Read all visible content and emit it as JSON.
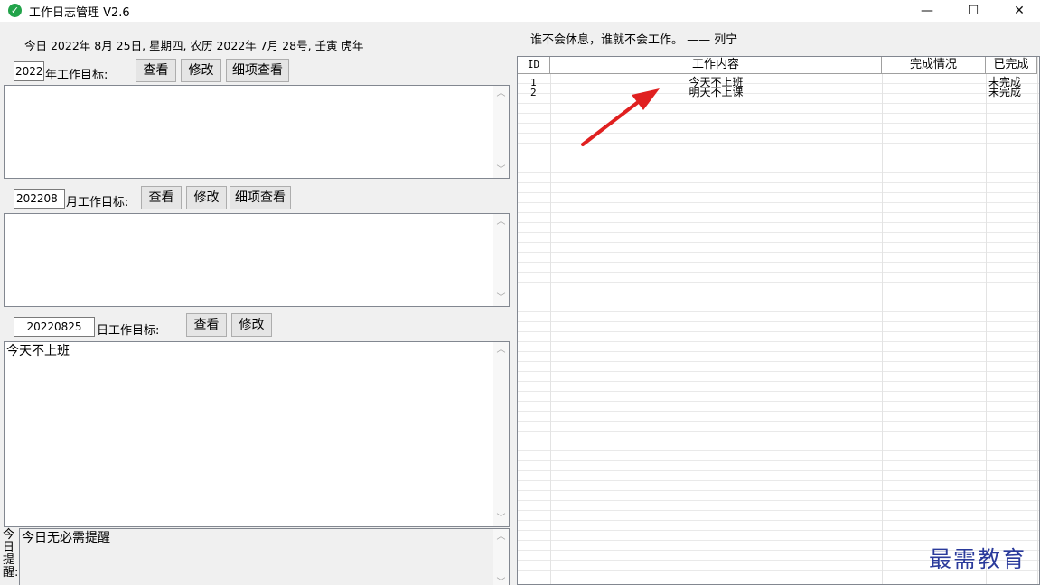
{
  "window": {
    "title": "工作日志管理 V2.6",
    "icon": "check-circle-icon",
    "minimize_glyph": "—",
    "maximize_glyph": "☐",
    "close_glyph": "✕"
  },
  "today_line": "今日 2022年 8月 25日, 星期四, 农历 2022年 7月 28号, 壬寅 虎年",
  "year_goal": {
    "value": "2022",
    "label": "年工作目标:",
    "view_button": "查看",
    "edit_button": "修改",
    "detail_button": "细项查看",
    "content": ""
  },
  "month_goal": {
    "value": "202208",
    "label": "月工作目标:",
    "view_button": "查看",
    "edit_button": "修改",
    "detail_button": "细项查看",
    "content": ""
  },
  "day_goal": {
    "value": "20220825",
    "label": "日工作目标:",
    "view_button": "查看",
    "edit_button": "修改",
    "content": "今天不上班"
  },
  "reminder": {
    "label_chars": [
      "今",
      "日",
      "提",
      "醒:"
    ],
    "content": "今日无必需提醒"
  },
  "quote": "谁不会休息，谁就不会工作。 —— 列宁",
  "table": {
    "columns": [
      "ID",
      "工作内容",
      "完成情况",
      "已完成"
    ],
    "rows": [
      {
        "id": "1",
        "content": "今天不上班",
        "status": "",
        "done": "未完成"
      },
      {
        "id": "2",
        "content": "明天不上课",
        "status": "",
        "done": "未完成"
      }
    ]
  },
  "watermark": "最需教育",
  "colors": {
    "arrow": "#e02020",
    "watermark": "#2a3a9b",
    "icon_green": "#22a34a"
  }
}
